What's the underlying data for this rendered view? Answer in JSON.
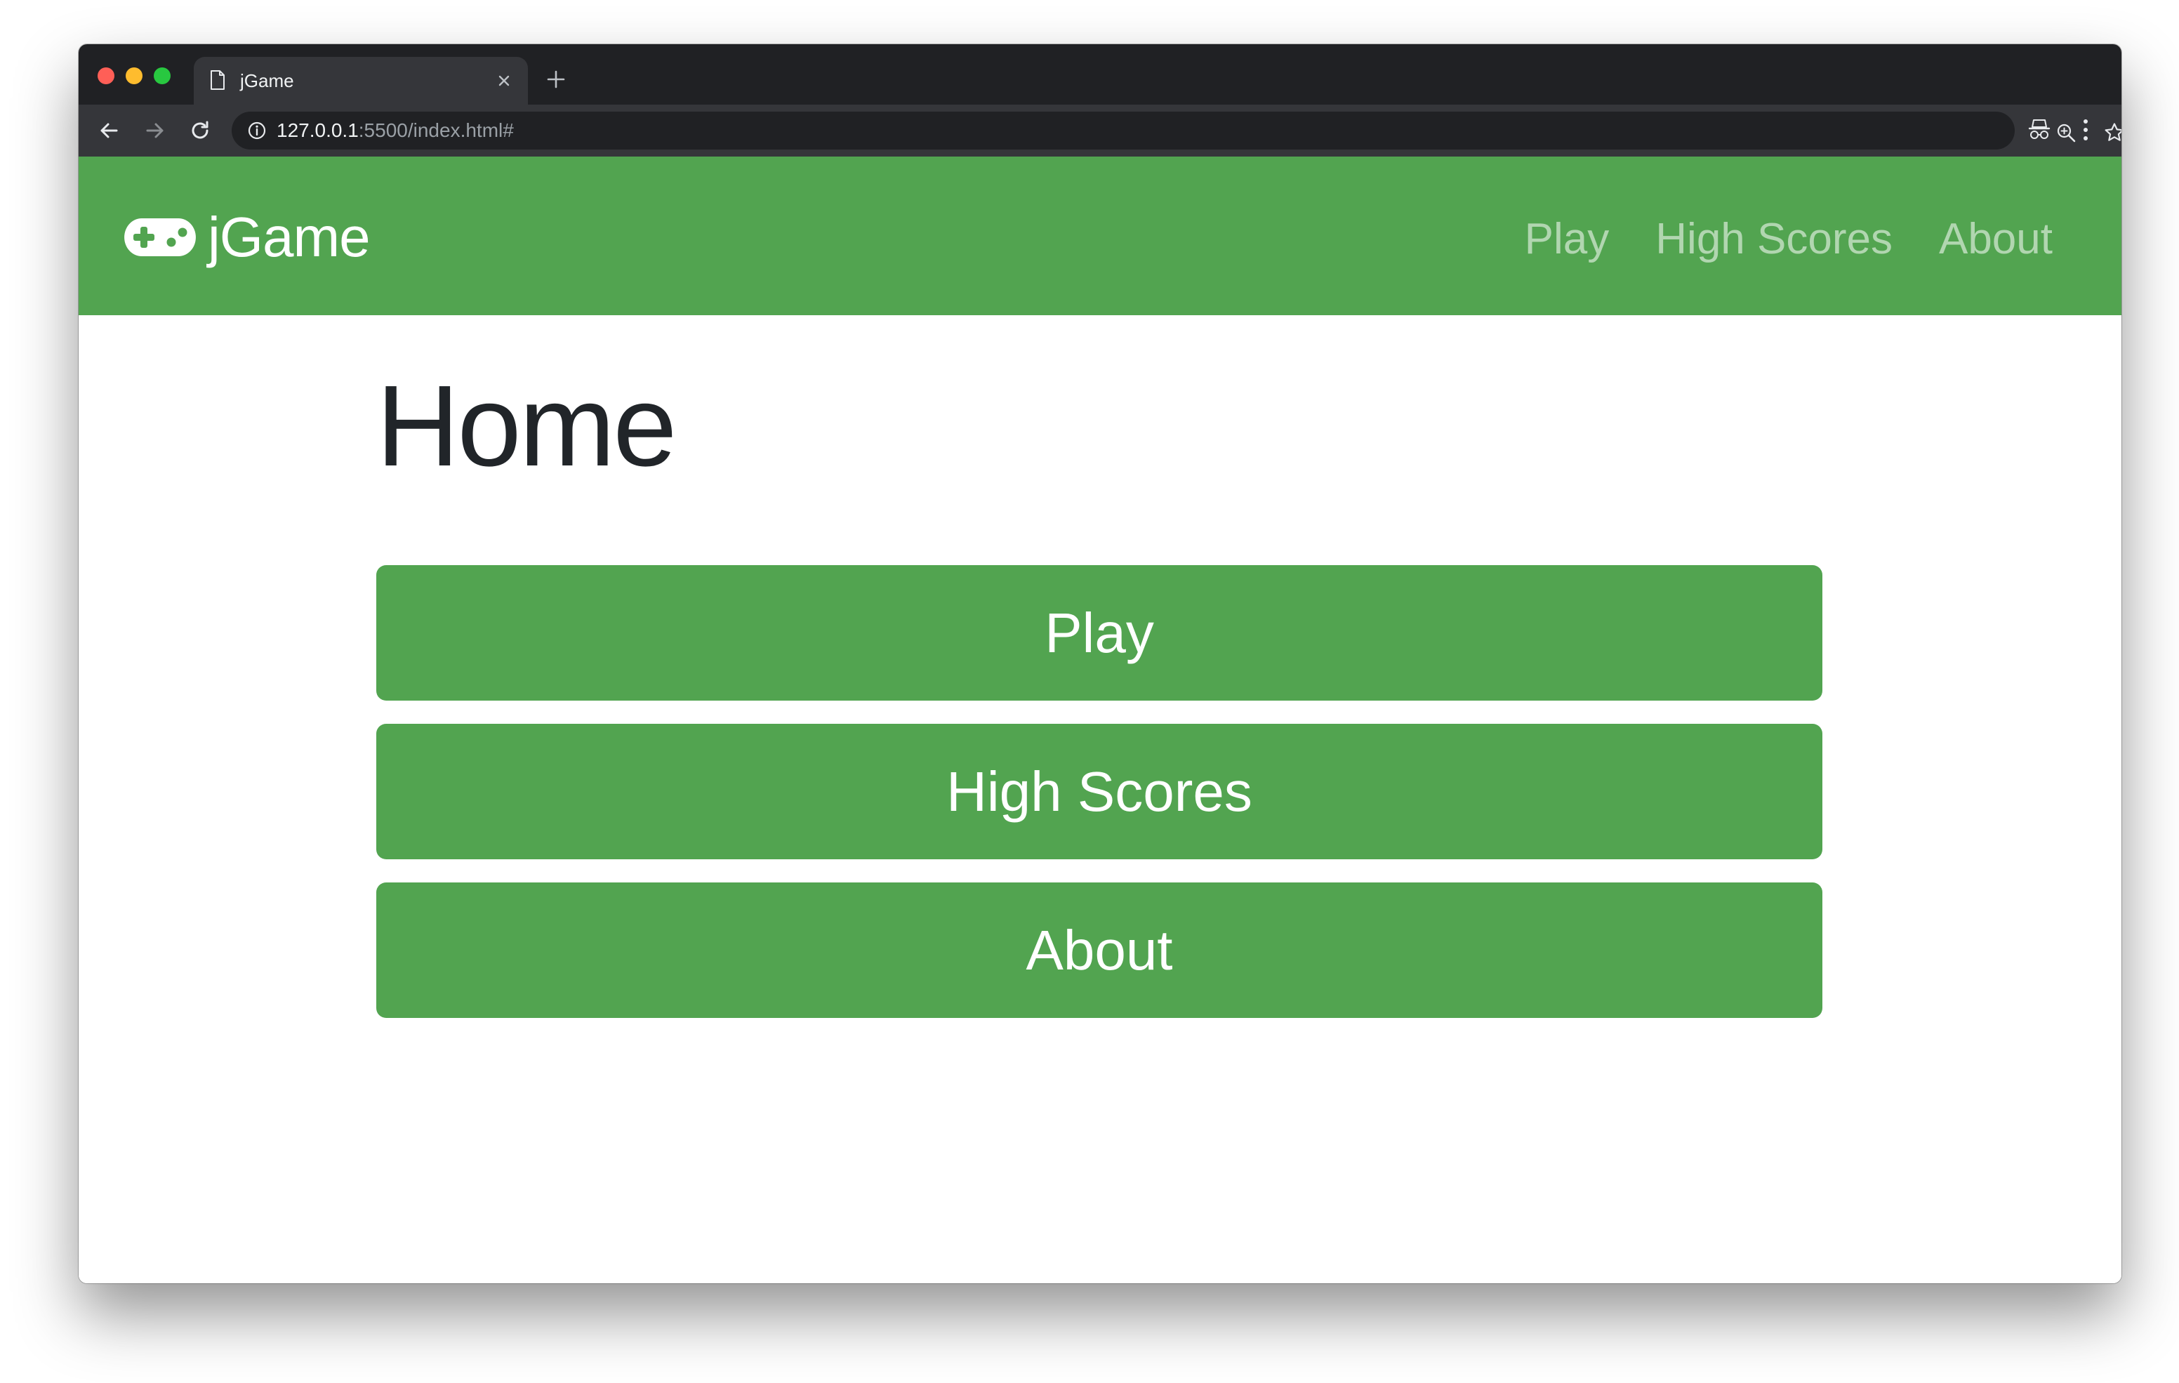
{
  "browser": {
    "tab_title": "jGame",
    "url_host": "127.0.0.1",
    "url_path": ":5500/index.html#"
  },
  "navbar": {
    "brand": "jGame",
    "links": [
      {
        "label": "Play"
      },
      {
        "label": "High Scores"
      },
      {
        "label": "About"
      }
    ]
  },
  "main": {
    "title": "Home",
    "buttons": [
      {
        "label": "Play"
      },
      {
        "label": "High Scores"
      },
      {
        "label": "About"
      }
    ]
  },
  "colors": {
    "brand_green": "#52a450",
    "chrome_dark": "#202124",
    "chrome_toolbar": "#35363a",
    "heading_text": "#212529"
  },
  "icons": {
    "brand": "gamepad-icon",
    "tab": "document-icon",
    "address": "info-icon"
  }
}
